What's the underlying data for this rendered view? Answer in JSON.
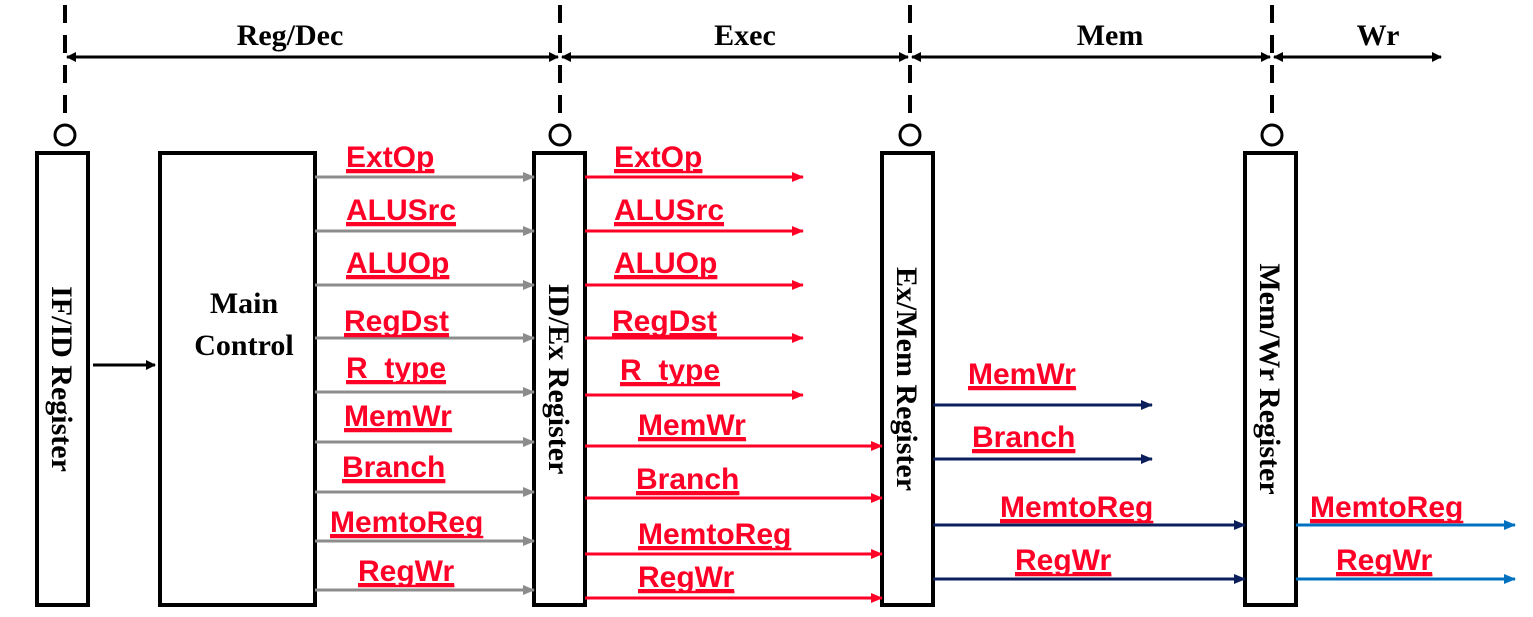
{
  "stages": [
    {
      "label": "Reg/Dec"
    },
    {
      "label": "Exec"
    },
    {
      "label": "Mem"
    },
    {
      "label": "Wr"
    }
  ],
  "registers": [
    {
      "label": "IF/ID Register"
    },
    {
      "label": "ID/Ex Register"
    },
    {
      "label": "Ex/Mem Register"
    },
    {
      "label": "Mem/Wr Register"
    }
  ],
  "main_control": {
    "line1": "Main",
    "line2": "Control"
  },
  "colors": {
    "signal_text": "#ff0027",
    "decode_wire": "#8c8c8c",
    "exec_wire": "#ff0027",
    "mem_wire": "#0b1f5c",
    "wr_wire": "#0070c0"
  },
  "signals": {
    "decode": [
      "ExtOp",
      "ALUSrc",
      "ALUOp",
      "RegDst",
      "R_type",
      "MemWr",
      "Branch",
      "MemtoReg",
      "RegWr"
    ],
    "exec": [
      "ExtOp",
      "ALUSrc",
      "ALUOp",
      "RegDst",
      "R_type",
      "MemWr",
      "Branch",
      "MemtoReg",
      "RegWr"
    ],
    "mem": [
      "MemWr",
      "Branch",
      "MemtoReg",
      "RegWr"
    ],
    "wr": [
      "MemtoReg",
      "RegWr"
    ]
  }
}
